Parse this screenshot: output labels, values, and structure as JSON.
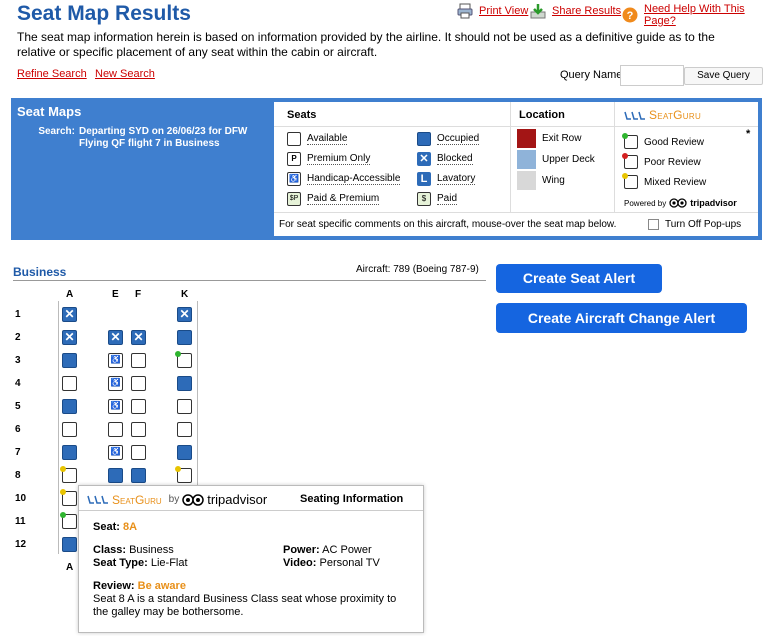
{
  "header": {
    "title": "Seat Map Results",
    "print_view": "Print View",
    "share_results": "Share Results",
    "help": "Need Help With This Page?"
  },
  "disclaimer": "The seat map information herein is based on information provided by the airline. It should not be used as a definitive guide as to the relative or specific placement of any seat within the cabin or aircraft.",
  "links": {
    "refine": "Refine Search",
    "new_search": "New Search"
  },
  "query": {
    "label": "Query Name:",
    "value": "",
    "save": "Save Query"
  },
  "seat_maps": {
    "title": "Seat Maps",
    "search_label": "Search:",
    "search_desc": "Departing SYD on 26/06/23 for DFW Flying QF flight 7 in Business",
    "legend": {
      "seats_title": "Seats",
      "seats": [
        "Available",
        "Premium Only",
        "Handicap-Accessible",
        "Paid & Premium"
      ],
      "seats2": [
        "Occupied",
        "Blocked",
        "Lavatory",
        "Paid"
      ],
      "location_title": "Location",
      "locations": [
        "Exit Row",
        "Upper Deck",
        "Wing"
      ],
      "location_colors": [
        "#a31515",
        "#8fb3d9",
        "#d8d8d8"
      ],
      "seatguru_logo": "SeatGuru",
      "reviews": [
        "Good Review",
        "Poor Review",
        "Mixed Review"
      ],
      "review_colors": [
        "#2fb52f",
        "#d42020",
        "#e8c400"
      ],
      "powered_by": "Powered by",
      "tripadvisor": "tripadvisor",
      "note": "For seat specific comments on this aircraft, mouse-over the seat map below.",
      "popup_toggle": "Turn Off Pop-ups",
      "asterisk": "*"
    }
  },
  "cabin": {
    "name": "Business",
    "aircraft": "Aircraft: 789 (Boeing 787-9)",
    "columns": [
      "A",
      "E",
      "F",
      "K"
    ],
    "rows": [
      "1",
      "2",
      "3",
      "4",
      "5",
      "6",
      "7",
      "8",
      "10",
      "11",
      "12"
    ],
    "footer_col": "A"
  },
  "buttons": {
    "seat_alert": "Create Seat Alert",
    "aircraft_alert": "Create Aircraft Change Alert"
  },
  "tooltip": {
    "seatguru": "SeatGuru",
    "by": "by",
    "tripadvisor": "tripadvisor",
    "heading": "Seating Information",
    "seat_label": "Seat:",
    "seat_value": "8A",
    "class_label": "Class:",
    "class_value": "Business",
    "type_label": "Seat Type:",
    "type_value": "Lie-Flat",
    "power_label": "Power:",
    "power_value": "AC Power",
    "video_label": "Video:",
    "video_value": "Personal TV",
    "review_label": "Review:",
    "review_value": "Be aware",
    "review_text": "Seat 8 A is a standard Business Class seat whose proximity to the galley may be bothersome."
  },
  "colors": {
    "title_blue": "#1f5aa8",
    "panel_blue": "#3f7fcf",
    "button_blue": "#1565e0",
    "accent_orange": "#e8901a",
    "link_red": "#cc0000"
  }
}
